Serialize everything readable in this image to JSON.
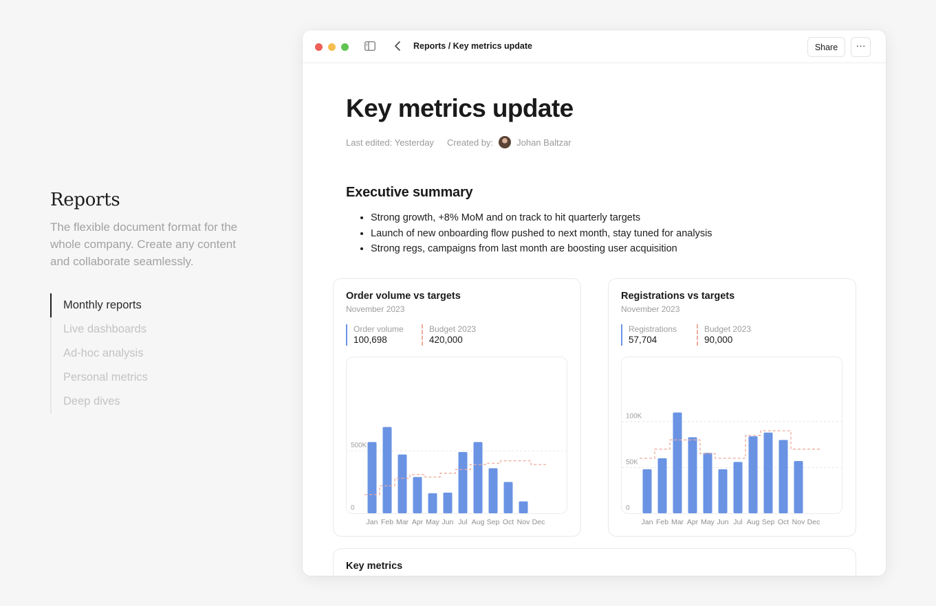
{
  "left_panel": {
    "title": "Reports",
    "description": "The flexible document format for the whole company. Create any content and collaborate seamlessly.",
    "nav": [
      {
        "label": "Monthly reports",
        "active": true
      },
      {
        "label": "Live dashboards",
        "active": false
      },
      {
        "label": "Ad-hoc analysis",
        "active": false
      },
      {
        "label": "Personal metrics",
        "active": false
      },
      {
        "label": "Deep dives",
        "active": false
      }
    ]
  },
  "window": {
    "breadcrumb": "Reports / Key metrics update",
    "share_label": "Share",
    "more_label": "···",
    "icons": [
      "sidebar-toggle-icon",
      "chevron-left-icon"
    ]
  },
  "document": {
    "title": "Key metrics update",
    "last_edited": "Last edited: Yesterday",
    "created_by_label": "Created by:",
    "author": "Johan Baltzar",
    "summary_title": "Executive summary",
    "bullets": [
      "Strong growth, +8% MoM and on track to hit quarterly targets",
      "Launch of new onboarding flow pushed to next month, stay tuned for analysis",
      "Strong regs, campaigns from last month are boosting user acquisition"
    ],
    "key_metrics_title": "Key metrics"
  },
  "colors": {
    "bar": "#6a93e4",
    "target": "#eeaa9a"
  },
  "chart_data": [
    {
      "type": "bar",
      "title": "Order volume vs targets",
      "subtitle": "November 2023",
      "legend": [
        {
          "label": "Order volume",
          "value": "100,698",
          "style": "solid"
        },
        {
          "label": "Budget 2023",
          "value": "420,000",
          "style": "dashed"
        }
      ],
      "categories": [
        "Jan",
        "Feb",
        "Mar",
        "Apr",
        "May",
        "Jun",
        "Jul",
        "Aug",
        "Sep",
        "Oct",
        "Nov",
        "Dec"
      ],
      "ylim": [
        0,
        1100000
      ],
      "yticks": [
        {
          "value": 0,
          "label": "0"
        },
        {
          "value": 500000,
          "label": "500K"
        }
      ],
      "series": [
        {
          "kind": "bar",
          "values": [
            570000,
            690000,
            470000,
            290000,
            160000,
            165000,
            490000,
            570000,
            360000,
            250000,
            95000,
            null
          ]
        },
        {
          "kind": "target",
          "values": [
            150000,
            220000,
            280000,
            310000,
            290000,
            320000,
            350000,
            390000,
            400000,
            420000,
            420000,
            390000
          ]
        }
      ]
    },
    {
      "type": "bar",
      "title": "Registrations vs targets",
      "subtitle": "November 2023",
      "legend": [
        {
          "label": "Registrations",
          "value": "57,704",
          "style": "solid"
        },
        {
          "label": "Budget 2023",
          "value": "90,000",
          "style": "dashed"
        }
      ],
      "categories": [
        "Jan",
        "Feb",
        "Mar",
        "Apr",
        "May",
        "Jun",
        "Jul",
        "Aug",
        "Sep",
        "Oct",
        "Nov",
        "Dec"
      ],
      "ylim": [
        0,
        150000
      ],
      "yticks": [
        {
          "value": 0,
          "label": "0"
        },
        {
          "value": 50000,
          "label": "50K"
        },
        {
          "value": 100000,
          "label": "100K"
        }
      ],
      "series": [
        {
          "kind": "bar",
          "values": [
            48000,
            60000,
            110000,
            83000,
            66000,
            48000,
            56000,
            84000,
            88000,
            80000,
            57000,
            null
          ]
        },
        {
          "kind": "target",
          "values": [
            60000,
            70000,
            80000,
            80000,
            65000,
            60000,
            60000,
            85000,
            90000,
            90000,
            70000,
            70000
          ]
        }
      ]
    }
  ]
}
